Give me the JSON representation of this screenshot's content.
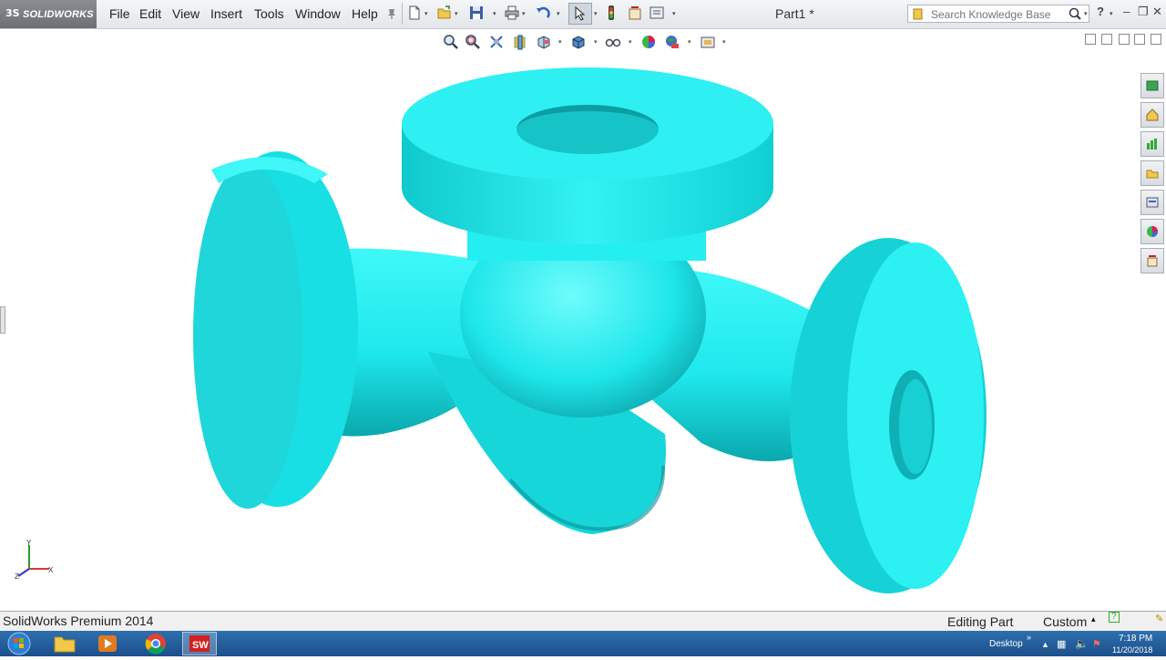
{
  "app": {
    "brand": "SOLIDWORKS",
    "brand_prefix": "3S",
    "document_title": "Part1 *"
  },
  "menu": [
    "File",
    "Edit",
    "View",
    "Insert",
    "Tools",
    "Window",
    "Help"
  ],
  "search": {
    "placeholder": "Search Knowledge Base"
  },
  "status": {
    "product": "SolidWorks Premium 2014",
    "mode": "Editing Part",
    "units": "Custom"
  },
  "taskbar": {
    "toolbar_label": "Desktop",
    "time": "7:18 PM",
    "date": "11/20/2018"
  },
  "triad": {
    "x_label": "X",
    "y_label": "Y",
    "z_label": "Z"
  },
  "colors": {
    "model": "#1ff0f0",
    "model_shadow": "#0a9aa0",
    "taskbar": "#1f5b99"
  },
  "icons": {
    "standard_toolbar": [
      "new-document-icon",
      "open-icon",
      "save-icon",
      "print-icon",
      "undo-icon",
      "select-icon",
      "rebuild-icon",
      "file-properties-icon",
      "options-icon"
    ],
    "heads_up": [
      "zoom-to-fit-icon",
      "zoom-to-area-icon",
      "previous-view-icon",
      "section-view-icon",
      "view-orientation-icon",
      "display-style-icon",
      "hide-show-items-icon",
      "edit-appearance-icon",
      "apply-scene-icon",
      "view-settings-icon"
    ],
    "task_pane": [
      "solidworks-resources-icon",
      "design-library-icon",
      "file-explorer-icon",
      "view-palette-icon",
      "appearances-scenes-icon",
      "custom-properties-icon"
    ]
  }
}
